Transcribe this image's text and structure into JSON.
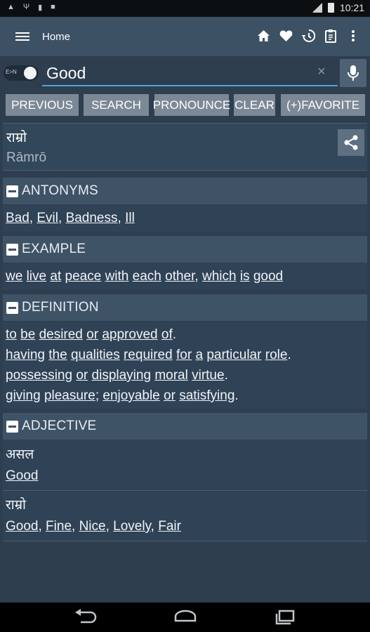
{
  "status_bar": {
    "time": "10:21"
  },
  "toolbar": {
    "title": "Home"
  },
  "search": {
    "value": "Good",
    "toggle_label": "E>N",
    "clear_glyph": "×"
  },
  "buttons": {
    "previous": "PREVIOUS",
    "search": "SEARCH",
    "pronounce": "PRONOUNCE",
    "clear": "CLEAR",
    "favorite": "(+)FAVORITE"
  },
  "word": {
    "nepali": "राम्रो",
    "roman": "Rāmrō"
  },
  "antonyms": {
    "title": "ANTONYMS",
    "words": [
      "Bad",
      "Evil",
      "Badness",
      "Ill"
    ]
  },
  "example": {
    "title": "EXAMPLE",
    "lines": [
      [
        {
          "w": "we",
          "l": true
        },
        {
          "w": " ",
          "l": false
        },
        {
          "w": "live",
          "l": true
        },
        {
          "w": " ",
          "l": false
        },
        {
          "w": "at",
          "l": true
        },
        {
          "w": " ",
          "l": false
        },
        {
          "w": "peace",
          "l": true
        },
        {
          "w": " ",
          "l": false
        },
        {
          "w": "with",
          "l": true
        },
        {
          "w": " ",
          "l": false
        },
        {
          "w": "each",
          "l": true
        },
        {
          "w": " ",
          "l": false
        },
        {
          "w": "other",
          "l": true
        },
        {
          "w": ", ",
          "l": false
        },
        {
          "w": "which",
          "l": true
        },
        {
          "w": " ",
          "l": false
        },
        {
          "w": "is",
          "l": true
        },
        {
          "w": " ",
          "l": false
        },
        {
          "w": "good",
          "l": true
        }
      ]
    ]
  },
  "definition": {
    "title": "DEFINITION",
    "lines": [
      [
        {
          "w": "to",
          "l": true
        },
        {
          "w": " ",
          "l": false
        },
        {
          "w": "be",
          "l": true
        },
        {
          "w": " ",
          "l": false
        },
        {
          "w": "desired",
          "l": true
        },
        {
          "w": " ",
          "l": false
        },
        {
          "w": "or",
          "l": true
        },
        {
          "w": " ",
          "l": false
        },
        {
          "w": "approved",
          "l": true
        },
        {
          "w": " ",
          "l": false
        },
        {
          "w": "of",
          "l": true
        },
        {
          "w": ".",
          "l": false
        }
      ],
      [
        {
          "w": "having",
          "l": true
        },
        {
          "w": " ",
          "l": false
        },
        {
          "w": "the",
          "l": true
        },
        {
          "w": " ",
          "l": false
        },
        {
          "w": "qualities",
          "l": true
        },
        {
          "w": " ",
          "l": false
        },
        {
          "w": "required",
          "l": true
        },
        {
          "w": " ",
          "l": false
        },
        {
          "w": "for",
          "l": true
        },
        {
          "w": " ",
          "l": false
        },
        {
          "w": "a",
          "l": true
        },
        {
          "w": " ",
          "l": false
        },
        {
          "w": "particular",
          "l": true
        },
        {
          "w": " ",
          "l": false
        },
        {
          "w": "role",
          "l": true
        },
        {
          "w": ".",
          "l": false
        }
      ],
      [
        {
          "w": "possessing",
          "l": true
        },
        {
          "w": " ",
          "l": false
        },
        {
          "w": "or",
          "l": true
        },
        {
          "w": " ",
          "l": false
        },
        {
          "w": "displaying",
          "l": true
        },
        {
          "w": " ",
          "l": false
        },
        {
          "w": "moral",
          "l": true
        },
        {
          "w": " ",
          "l": false
        },
        {
          "w": "virtue",
          "l": true
        },
        {
          "w": ".",
          "l": false
        }
      ],
      [
        {
          "w": "giving",
          "l": true
        },
        {
          "w": " ",
          "l": false
        },
        {
          "w": "pleasure",
          "l": true
        },
        {
          "w": "; ",
          "l": false
        },
        {
          "w": "enjoyable",
          "l": true
        },
        {
          "w": " ",
          "l": false
        },
        {
          "w": "or",
          "l": true
        },
        {
          "w": " ",
          "l": false
        },
        {
          "w": "satisfying",
          "l": true
        },
        {
          "w": ".",
          "l": false
        }
      ]
    ]
  },
  "adjective": {
    "title": "ADJECTIVE",
    "items": [
      {
        "nepali": "असल",
        "words": [
          "Good"
        ]
      },
      {
        "nepali": "राम्रो",
        "words": [
          "Good",
          "Fine",
          "Nice",
          "Lovely",
          "Fair"
        ]
      }
    ]
  },
  "colors": {
    "background": "#2e3e4f",
    "toolbar": "#3d5165",
    "section_header": "#3f5366",
    "button": "#7b8996",
    "accent_underline": "#4fa3d9"
  },
  "icons": {
    "toolbar": [
      "menu-icon",
      "home-icon",
      "heart-icon",
      "history-icon",
      "clipboard-icon",
      "more-vert-icon"
    ],
    "search": [
      "close-icon",
      "mic-icon"
    ],
    "card": [
      "share-icon"
    ],
    "nav": [
      "back-icon",
      "home-nav-icon",
      "recents-icon"
    ]
  }
}
